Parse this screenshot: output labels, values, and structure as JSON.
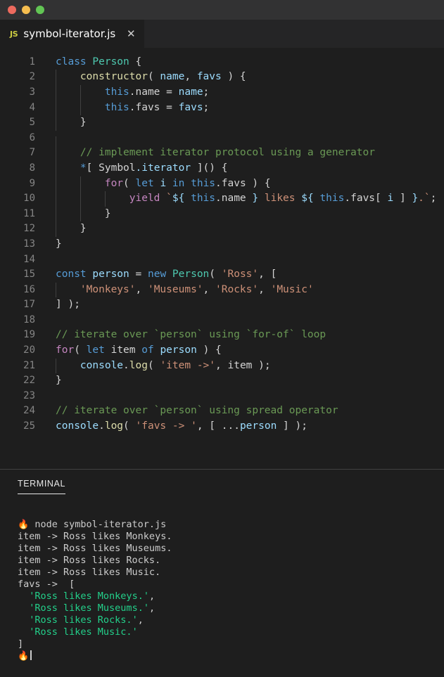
{
  "window": {
    "traffic_lights": [
      {
        "name": "close",
        "color": "#ed6a5e"
      },
      {
        "name": "minimize",
        "color": "#f5bd4f"
      },
      {
        "name": "zoom",
        "color": "#62c554"
      }
    ]
  },
  "tab": {
    "icon_label": "JS",
    "filename": "symbol-iterator.js",
    "close_glyph": "✕"
  },
  "editor": {
    "lines": [
      {
        "n": "1",
        "indent_guides": 0,
        "tokens": [
          {
            "t": "class ",
            "c": "k"
          },
          {
            "t": "Person",
            "c": "typ"
          },
          {
            "t": " {",
            "c": "pl"
          }
        ]
      },
      {
        "n": "2",
        "indent_guides": 1,
        "tokens": [
          {
            "t": "    ",
            "c": "pl"
          },
          {
            "t": "constructor",
            "c": "fn"
          },
          {
            "t": "( ",
            "c": "pl"
          },
          {
            "t": "name",
            "c": "var"
          },
          {
            "t": ", ",
            "c": "pl"
          },
          {
            "t": "favs",
            "c": "var"
          },
          {
            "t": " ) {",
            "c": "pl"
          }
        ]
      },
      {
        "n": "3",
        "indent_guides": 2,
        "tokens": [
          {
            "t": "        ",
            "c": "pl"
          },
          {
            "t": "this",
            "c": "k"
          },
          {
            "t": ".name ",
            "c": "pl"
          },
          {
            "t": "= ",
            "c": "pl"
          },
          {
            "t": "name",
            "c": "var"
          },
          {
            "t": ";",
            "c": "pl"
          }
        ]
      },
      {
        "n": "4",
        "indent_guides": 2,
        "tokens": [
          {
            "t": "        ",
            "c": "pl"
          },
          {
            "t": "this",
            "c": "k"
          },
          {
            "t": ".favs ",
            "c": "pl"
          },
          {
            "t": "= ",
            "c": "pl"
          },
          {
            "t": "favs",
            "c": "var"
          },
          {
            "t": ";",
            "c": "pl"
          }
        ]
      },
      {
        "n": "5",
        "indent_guides": 1,
        "tokens": [
          {
            "t": "    }",
            "c": "pl"
          }
        ]
      },
      {
        "n": "6",
        "indent_guides": 1,
        "tokens": []
      },
      {
        "n": "7",
        "indent_guides": 1,
        "tokens": [
          {
            "t": "    ",
            "c": "pl"
          },
          {
            "t": "// implement iterator protocol using a generator",
            "c": "cmt"
          }
        ]
      },
      {
        "n": "8",
        "indent_guides": 1,
        "tokens": [
          {
            "t": "    ",
            "c": "pl"
          },
          {
            "t": "*",
            "c": "k"
          },
          {
            "t": "[ ",
            "c": "pl"
          },
          {
            "t": "Symbol",
            "c": "pl"
          },
          {
            "t": ".iterator",
            "c": "var"
          },
          {
            "t": " ]() {",
            "c": "pl"
          }
        ]
      },
      {
        "n": "9",
        "indent_guides": 2,
        "tokens": [
          {
            "t": "        ",
            "c": "pl"
          },
          {
            "t": "for",
            "c": "ctl"
          },
          {
            "t": "( ",
            "c": "pl"
          },
          {
            "t": "let ",
            "c": "k"
          },
          {
            "t": "i ",
            "c": "var"
          },
          {
            "t": "in ",
            "c": "k"
          },
          {
            "t": "this",
            "c": "k"
          },
          {
            "t": ".favs ) {",
            "c": "pl"
          }
        ]
      },
      {
        "n": "10",
        "indent_guides": 3,
        "tokens": [
          {
            "t": "            ",
            "c": "pl"
          },
          {
            "t": "yield ",
            "c": "ctl"
          },
          {
            "t": "`",
            "c": "str"
          },
          {
            "t": "${",
            "c": "var"
          },
          {
            "t": " ",
            "c": "pl"
          },
          {
            "t": "this",
            "c": "k"
          },
          {
            "t": ".name",
            "c": "pl"
          },
          {
            "t": " ",
            "c": "pl"
          },
          {
            "t": "}",
            "c": "var"
          },
          {
            "t": " likes ",
            "c": "str"
          },
          {
            "t": "${",
            "c": "var"
          },
          {
            "t": " ",
            "c": "pl"
          },
          {
            "t": "this",
            "c": "k"
          },
          {
            "t": ".favs",
            "c": "pl"
          },
          {
            "t": "[ ",
            "c": "pl"
          },
          {
            "t": "i",
            "c": "var"
          },
          {
            "t": " ] ",
            "c": "pl"
          },
          {
            "t": "}",
            "c": "var"
          },
          {
            "t": ".`",
            "c": "str"
          },
          {
            "t": ";",
            "c": "pl"
          }
        ]
      },
      {
        "n": "11",
        "indent_guides": 2,
        "tokens": [
          {
            "t": "        }",
            "c": "pl"
          }
        ]
      },
      {
        "n": "12",
        "indent_guides": 1,
        "tokens": [
          {
            "t": "    }",
            "c": "pl"
          }
        ]
      },
      {
        "n": "13",
        "indent_guides": 0,
        "tokens": [
          {
            "t": "}",
            "c": "pl"
          }
        ]
      },
      {
        "n": "14",
        "indent_guides": 0,
        "tokens": []
      },
      {
        "n": "15",
        "indent_guides": 0,
        "tokens": [
          {
            "t": "const ",
            "c": "k"
          },
          {
            "t": "person",
            "c": "var"
          },
          {
            "t": " = ",
            "c": "pl"
          },
          {
            "t": "new ",
            "c": "k"
          },
          {
            "t": "Person",
            "c": "typ"
          },
          {
            "t": "( ",
            "c": "pl"
          },
          {
            "t": "'Ross'",
            "c": "str"
          },
          {
            "t": ", [",
            "c": "pl"
          }
        ]
      },
      {
        "n": "16",
        "indent_guides": 1,
        "tokens": [
          {
            "t": "    ",
            "c": "pl"
          },
          {
            "t": "'Monkeys'",
            "c": "str"
          },
          {
            "t": ", ",
            "c": "pl"
          },
          {
            "t": "'Museums'",
            "c": "str"
          },
          {
            "t": ", ",
            "c": "pl"
          },
          {
            "t": "'Rocks'",
            "c": "str"
          },
          {
            "t": ", ",
            "c": "pl"
          },
          {
            "t": "'Music'",
            "c": "str"
          }
        ]
      },
      {
        "n": "17",
        "indent_guides": 0,
        "tokens": [
          {
            "t": "] );",
            "c": "pl"
          }
        ]
      },
      {
        "n": "18",
        "indent_guides": 0,
        "tokens": []
      },
      {
        "n": "19",
        "indent_guides": 0,
        "tokens": [
          {
            "t": "// iterate over `person` using `for-of` loop",
            "c": "cmt"
          }
        ]
      },
      {
        "n": "20",
        "indent_guides": 0,
        "tokens": [
          {
            "t": "for",
            "c": "ctl"
          },
          {
            "t": "( ",
            "c": "pl"
          },
          {
            "t": "let ",
            "c": "k"
          },
          {
            "t": "item ",
            "c": "pl"
          },
          {
            "t": "of ",
            "c": "k"
          },
          {
            "t": "person",
            "c": "var"
          },
          {
            "t": " ) {",
            "c": "pl"
          }
        ]
      },
      {
        "n": "21",
        "indent_guides": 1,
        "tokens": [
          {
            "t": "    ",
            "c": "pl"
          },
          {
            "t": "console",
            "c": "var"
          },
          {
            "t": ".",
            "c": "pl"
          },
          {
            "t": "log",
            "c": "fn"
          },
          {
            "t": "( ",
            "c": "pl"
          },
          {
            "t": "'item ->'",
            "c": "str"
          },
          {
            "t": ", ",
            "c": "pl"
          },
          {
            "t": "item",
            "c": "pl"
          },
          {
            "t": " );",
            "c": "pl"
          }
        ]
      },
      {
        "n": "22",
        "indent_guides": 0,
        "tokens": [
          {
            "t": "}",
            "c": "pl"
          }
        ]
      },
      {
        "n": "23",
        "indent_guides": 0,
        "tokens": []
      },
      {
        "n": "24",
        "indent_guides": 0,
        "tokens": [
          {
            "t": "// iterate over `person` using spread operator",
            "c": "cmt"
          }
        ]
      },
      {
        "n": "25",
        "indent_guides": 0,
        "tokens": [
          {
            "t": "console",
            "c": "var"
          },
          {
            "t": ".",
            "c": "pl"
          },
          {
            "t": "log",
            "c": "fn"
          },
          {
            "t": "( ",
            "c": "pl"
          },
          {
            "t": "'favs -> '",
            "c": "str"
          },
          {
            "t": ", [ ...",
            "c": "pl"
          },
          {
            "t": "person",
            "c": "var"
          },
          {
            "t": " ] );",
            "c": "pl"
          }
        ]
      }
    ]
  },
  "panel": {
    "tab_label": "TERMINAL",
    "terminal_lines": [
      {
        "segments": [
          {
            "t": "🔥",
            "c": "emoji"
          },
          {
            "t": " node symbol-iterator.js",
            "c": "t-white"
          }
        ]
      },
      {
        "segments": [
          {
            "t": "item -> Ross likes Monkeys.",
            "c": "t-white"
          }
        ]
      },
      {
        "segments": [
          {
            "t": "item -> Ross likes Museums.",
            "c": "t-white"
          }
        ]
      },
      {
        "segments": [
          {
            "t": "item -> Ross likes Rocks.",
            "c": "t-white"
          }
        ]
      },
      {
        "segments": [
          {
            "t": "item -> Ross likes Music.",
            "c": "t-white"
          }
        ]
      },
      {
        "segments": [
          {
            "t": "favs ->  [",
            "c": "t-white"
          }
        ]
      },
      {
        "segments": [
          {
            "t": "  ",
            "c": "t-white"
          },
          {
            "t": "'Ross likes Monkeys.'",
            "c": "t-green"
          },
          {
            "t": ",",
            "c": "t-white"
          }
        ]
      },
      {
        "segments": [
          {
            "t": "  ",
            "c": "t-white"
          },
          {
            "t": "'Ross likes Museums.'",
            "c": "t-green"
          },
          {
            "t": ",",
            "c": "t-white"
          }
        ]
      },
      {
        "segments": [
          {
            "t": "  ",
            "c": "t-white"
          },
          {
            "t": "'Ross likes Rocks.'",
            "c": "t-green"
          },
          {
            "t": ",",
            "c": "t-white"
          }
        ]
      },
      {
        "segments": [
          {
            "t": "  ",
            "c": "t-white"
          },
          {
            "t": "'Ross likes Music.'",
            "c": "t-green"
          }
        ]
      },
      {
        "segments": [
          {
            "t": "]",
            "c": "t-white"
          }
        ]
      },
      {
        "segments": [
          {
            "t": "🔥",
            "c": "emoji"
          }
        ],
        "cursor": true
      }
    ]
  }
}
